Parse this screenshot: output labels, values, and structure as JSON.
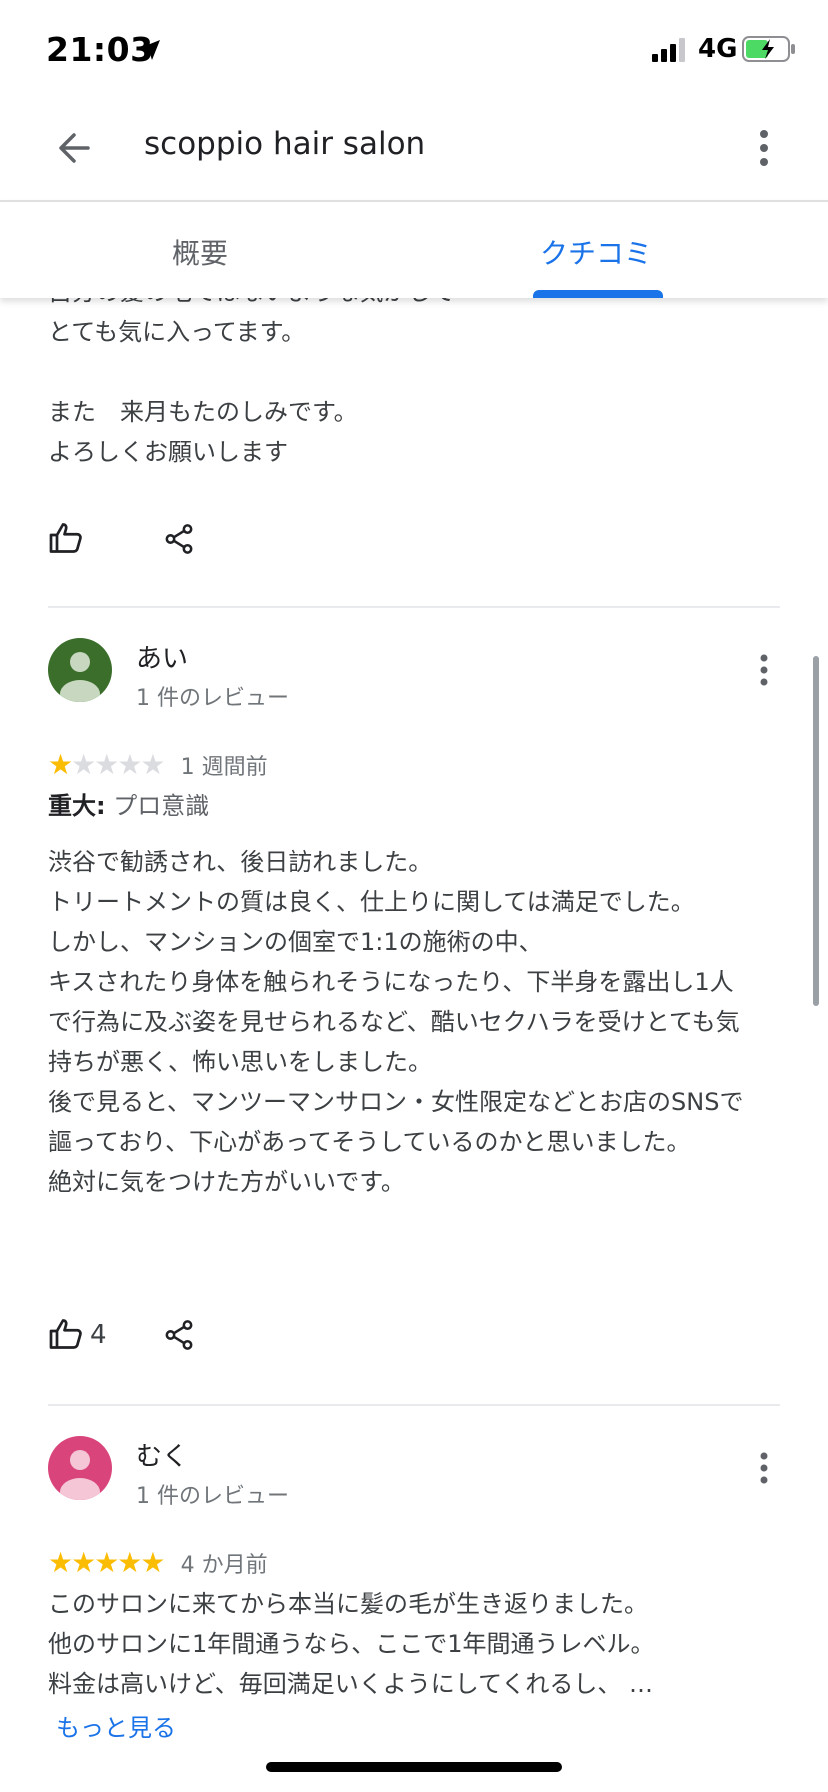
{
  "status_bar": {
    "time": "21:03",
    "network": "4G"
  },
  "app_bar": {
    "title": "scoppio hair salon"
  },
  "tabs": [
    {
      "label": "概要",
      "active": false
    },
    {
      "label": "クチコミ",
      "active": true
    }
  ],
  "previous_review": {
    "text": "自分の髪の毛ではないような気がして\nとても気に入ってます。\n\nまた　来月もたのしみです。\nよろしくお願いします"
  },
  "reviews": [
    {
      "name": "あい",
      "meta": "1 件のレビュー",
      "avatar_color": "#3b6e2b",
      "rating": 1,
      "stars_on": "★",
      "stars_off": "★★★★",
      "date": "1 週間前",
      "attribute_label": "重大:",
      "attribute_value": "プロ意識",
      "text": "渋谷で勧誘され、後日訪れました。\nトリートメントの質は良く、仕上りに関しては満足でした。\nしかし、マンションの個室で1:1の施術の中、\nキスされたり身体を触られそうになったり、下半身を露出し1人で行為に及ぶ姿を見せられるなど、酷いセクハラを受けとても気持ちが悪く、怖い思いをしました。\n後で見ると、マンツーマンサロン・女性限定などとお店のSNSで謳っており、下心があってそうしているのかと思いました。\n絶対に気をつけた方がいいです。",
      "likes": "4"
    },
    {
      "name": "むく",
      "meta": "1 件のレビュー",
      "avatar_color": "#d9457a",
      "rating": 5,
      "stars_on": "★★★★★",
      "stars_off": "",
      "date": "4 か月前",
      "text": "このサロンに来てから本当に髪の毛が生き返りました。\n他のサロンに1年間通うなら、ここで1年間通うレベル。\n料金は高いけど、毎回満足いくようにしてくれるし、 …",
      "read_more": "もっと見る"
    }
  ],
  "icons": {
    "back": "arrow-back-icon",
    "more": "more-vert-icon",
    "like": "thumb-up-icon",
    "share": "share-icon",
    "location": "location-arrow-icon"
  },
  "colors": {
    "accent": "#1a73e8",
    "star": "#fbbc04"
  }
}
